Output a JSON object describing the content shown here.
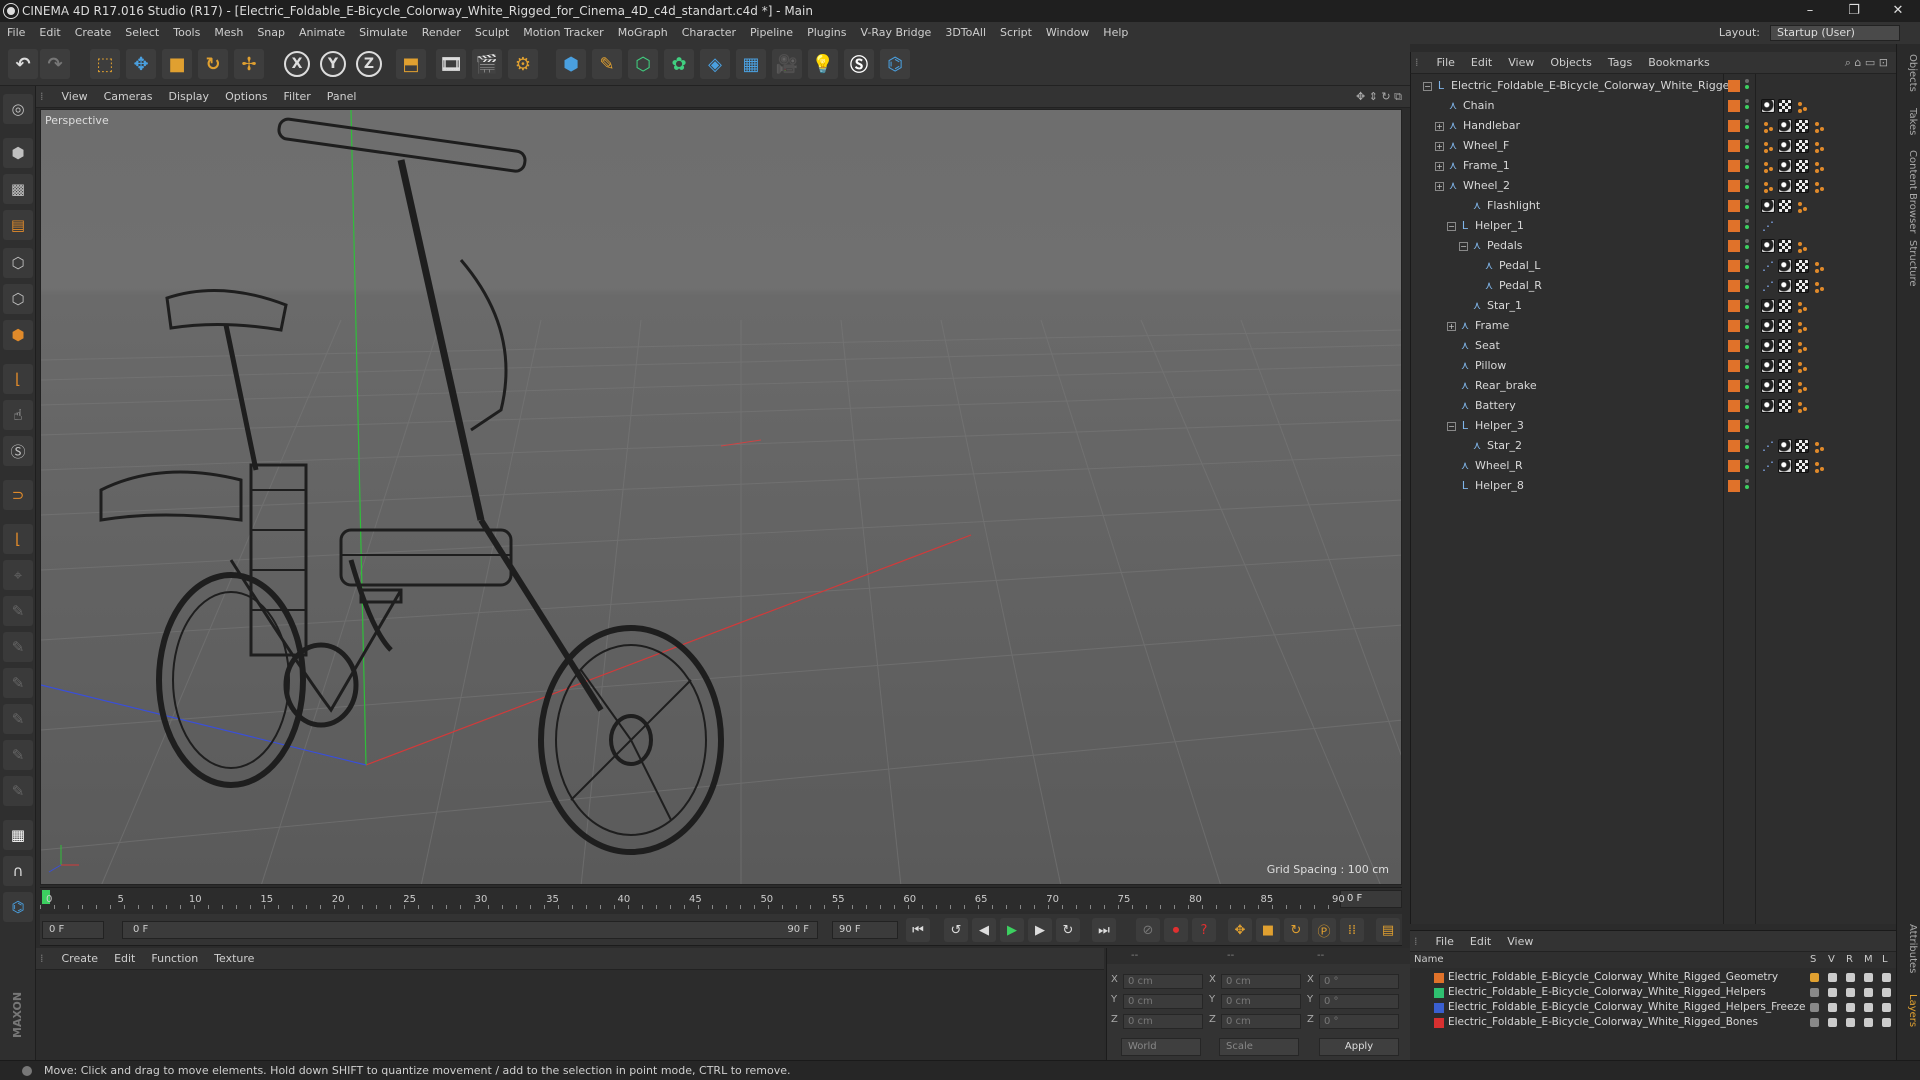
{
  "window": {
    "title": "CINEMA 4D R17.016 Studio (R17) - [Electric_Foldable_E-Bicycle_Colorway_White_Rigged_for_Cinema_4D_c4d_standart.c4d *] - Main",
    "controls": [
      "–",
      "❐",
      "✕"
    ]
  },
  "menubar": {
    "items": [
      "File",
      "Edit",
      "Create",
      "Select",
      "Tools",
      "Mesh",
      "Snap",
      "Animate",
      "Simulate",
      "Render",
      "Sculpt",
      "Motion Tracker",
      "MoGraph",
      "Character",
      "Pipeline",
      "Plugins",
      "V-Ray Bridge",
      "3DToAll",
      "Script",
      "Window",
      "Help"
    ],
    "layout_label": "Layout:",
    "layout_value": "Startup (User)"
  },
  "viewport": {
    "menu": [
      "View",
      "Cameras",
      "Display",
      "Options",
      "Filter",
      "Panel"
    ],
    "label": "Perspective",
    "grid_spacing": "Grid Spacing : 100 cm"
  },
  "timeline": {
    "ticks": [
      "0",
      "5",
      "10",
      "15",
      "20",
      "25",
      "30",
      "35",
      "40",
      "45",
      "50",
      "55",
      "60",
      "65",
      "70",
      "75",
      "80",
      "85",
      "90"
    ],
    "end_field": "0 F",
    "current_frame": "0 F",
    "range_start": "0 F",
    "range_end": "90 F",
    "max_frame": "90 F"
  },
  "material_manager": {
    "menu": [
      "Create",
      "Edit",
      "Function",
      "Texture"
    ]
  },
  "coordinates": {
    "rows": [
      {
        "a": "X",
        "av": "0 cm",
        "b": "X",
        "bv": "0 cm",
        "c": "X",
        "cv": "0 °"
      },
      {
        "a": "Y",
        "av": "0 cm",
        "b": "Y",
        "bv": "0 cm",
        "c": "Y",
        "cv": "0 °"
      },
      {
        "a": "Z",
        "av": "0 cm",
        "b": "Z",
        "bv": "0 cm",
        "c": "Z",
        "cv": "0 °"
      }
    ],
    "world": "World",
    "scale": "Scale",
    "apply": "Apply",
    "headers": [
      "--",
      "--",
      "--"
    ]
  },
  "status": "Move: Click and drag to move elements. Hold down SHIFT to quantize movement / add to the selection in point mode, CTRL to remove.",
  "object_manager": {
    "menu": [
      "File",
      "Edit",
      "View",
      "Objects",
      "Tags",
      "Bookmarks"
    ],
    "objects": [
      {
        "name": "Electric_Foldable_E-Bicycle_Colorway_White_Rigged",
        "indent": 0,
        "icon": "null-icon",
        "expand": "−",
        "tags": []
      },
      {
        "name": "Chain",
        "indent": 1,
        "icon": "bone-icon",
        "expand": "",
        "tags": [
          "ball",
          "chk",
          "dot"
        ]
      },
      {
        "name": "Handlebar",
        "indent": 1,
        "icon": "bone-icon",
        "expand": "+",
        "tags": [
          "dot",
          "ball",
          "chk",
          "dot"
        ]
      },
      {
        "name": "Wheel_F",
        "indent": 1,
        "icon": "bone-icon",
        "expand": "+",
        "tags": [
          "dot",
          "ball",
          "chk",
          "dot"
        ]
      },
      {
        "name": "Frame_1",
        "indent": 1,
        "icon": "bone-icon",
        "expand": "+",
        "tags": [
          "dot",
          "ball",
          "chk",
          "dot"
        ]
      },
      {
        "name": "Wheel_2",
        "indent": 1,
        "icon": "bone-icon",
        "expand": "+",
        "tags": [
          "dot",
          "ball",
          "chk",
          "dot"
        ]
      },
      {
        "name": "Flashlight",
        "indent": 3,
        "icon": "bone-icon",
        "expand": "",
        "tags": [
          "ball",
          "chk",
          "dot"
        ]
      },
      {
        "name": "Helper_1",
        "indent": 2,
        "icon": "null-icon",
        "expand": "−",
        "tags": [
          "blu"
        ]
      },
      {
        "name": "Pedals",
        "indent": 3,
        "icon": "bone-icon",
        "expand": "−",
        "tags": [
          "ball",
          "chk",
          "dot"
        ]
      },
      {
        "name": "Pedal_L",
        "indent": 4,
        "icon": "bone-icon",
        "expand": "",
        "tags": [
          "blu",
          "ball",
          "chk",
          "dot"
        ]
      },
      {
        "name": "Pedal_R",
        "indent": 4,
        "icon": "bone-icon",
        "expand": "",
        "tags": [
          "blu",
          "ball",
          "chk",
          "dot"
        ]
      },
      {
        "name": "Star_1",
        "indent": 3,
        "icon": "bone-icon",
        "expand": "",
        "tags": [
          "ball",
          "chk",
          "dot"
        ]
      },
      {
        "name": "Frame",
        "indent": 2,
        "icon": "bone-icon",
        "expand": "+",
        "tags": [
          "ball",
          "chk",
          "dot"
        ]
      },
      {
        "name": "Seat",
        "indent": 2,
        "icon": "bone-icon",
        "expand": "",
        "tags": [
          "ball",
          "chk",
          "dot"
        ]
      },
      {
        "name": "Pillow",
        "indent": 2,
        "icon": "bone-icon",
        "expand": "",
        "tags": [
          "ball",
          "chk",
          "dot"
        ]
      },
      {
        "name": "Rear_brake",
        "indent": 2,
        "icon": "bone-icon",
        "expand": "",
        "tags": [
          "ball",
          "chk",
          "dot"
        ]
      },
      {
        "name": "Battery",
        "indent": 2,
        "icon": "bone-icon",
        "expand": "",
        "tags": [
          "ball",
          "chk",
          "dot"
        ]
      },
      {
        "name": "Helper_3",
        "indent": 2,
        "icon": "null-icon",
        "expand": "−",
        "tags": []
      },
      {
        "name": "Star_2",
        "indent": 3,
        "icon": "bone-icon",
        "expand": "",
        "tags": [
          "blu",
          "ball",
          "chk",
          "dot"
        ]
      },
      {
        "name": "Wheel_R",
        "indent": 2,
        "icon": "bone-icon",
        "expand": "",
        "tags": [
          "blu",
          "ball",
          "chk",
          "dot"
        ]
      },
      {
        "name": "Helper_8",
        "indent": 2,
        "icon": "null-icon",
        "expand": "",
        "tags": []
      }
    ]
  },
  "side_tabs": [
    "Objects",
    "Takes",
    "Content Browser",
    "Structure",
    "Attributes",
    "Layers"
  ],
  "layer_manager": {
    "menu": [
      "File",
      "Edit",
      "View"
    ],
    "header_name": "Name",
    "header_cols": [
      "S",
      "V",
      "R",
      "M",
      "L"
    ],
    "layers": [
      {
        "name": "Electric_Foldable_E-Bicycle_Colorway_White_Rigged_Geometry",
        "color": "#e0722a"
      },
      {
        "name": "Electric_Foldable_E-Bicycle_Colorway_White_Rigged_Helpers",
        "color": "#2fc070"
      },
      {
        "name": "Electric_Foldable_E-Bicycle_Colorway_White_Rigged_Helpers_Freeze",
        "color": "#3a5fd0"
      },
      {
        "name": "Electric_Foldable_E-Bicycle_Colorway_White_Rigged_Bones",
        "color": "#d83030"
      }
    ]
  },
  "brand": "MAXON CINEMA 4D",
  "colors": {
    "accent": "#e0722a",
    "visible_dot": "#3cd060",
    "x_axis": "#d23a3a",
    "y_axis": "#2fbf3a",
    "z_axis": "#3a4fd8"
  }
}
